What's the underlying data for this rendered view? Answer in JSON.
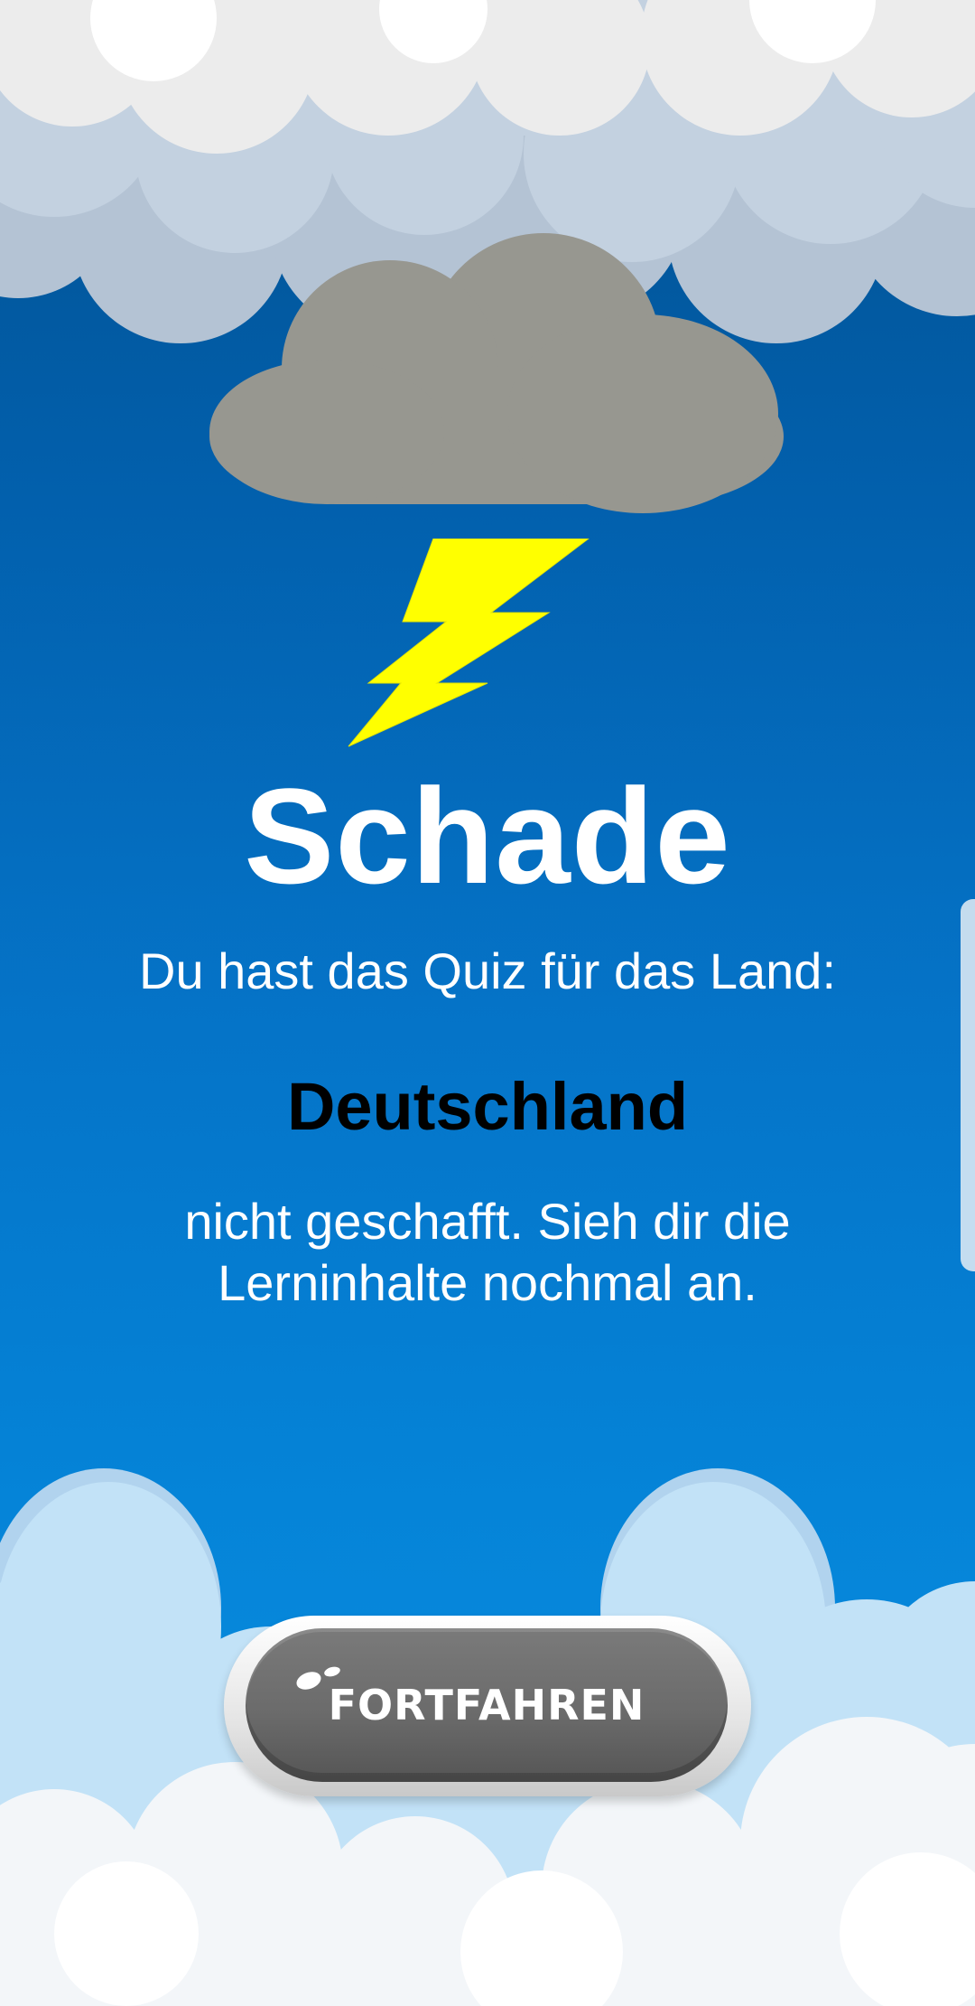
{
  "result": {
    "title": "Schade",
    "message_before": "Du hast das Quiz für das Land:",
    "country": "Deutschland",
    "message_after": "nicht geschafft. Sieh dir die Lerninhalte nochmal an."
  },
  "actions": {
    "continue_label": "FORTFAHREN"
  },
  "colors": {
    "sky_top": "#02508f",
    "sky_bottom": "#0a90e2",
    "storm_cloud": "#979790",
    "lightning": "#ffff00",
    "button": "#6b6b6b"
  },
  "icons": {
    "storm": "storm-cloud-icon",
    "bolt": "lightning-bolt-icon"
  }
}
